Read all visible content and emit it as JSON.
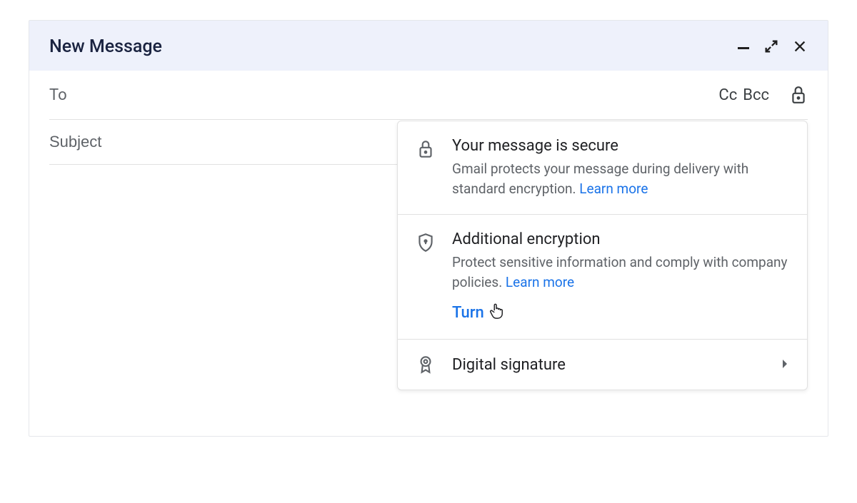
{
  "compose": {
    "title": "New Message",
    "to_label": "To",
    "cc_label": "Cc",
    "bcc_label": "Bcc",
    "subject_placeholder": "Subject"
  },
  "popup": {
    "secure": {
      "heading": "Your message is secure",
      "description": "Gmail protects your message during delivery with standard encryption. ",
      "learn_more": "Learn more"
    },
    "additional": {
      "heading": "Additional encryption",
      "description": "Protect sensitive information and comply with company policies. ",
      "learn_more": "Learn more",
      "turn_label": "Turn"
    },
    "signature": {
      "heading": "Digital signature"
    }
  }
}
